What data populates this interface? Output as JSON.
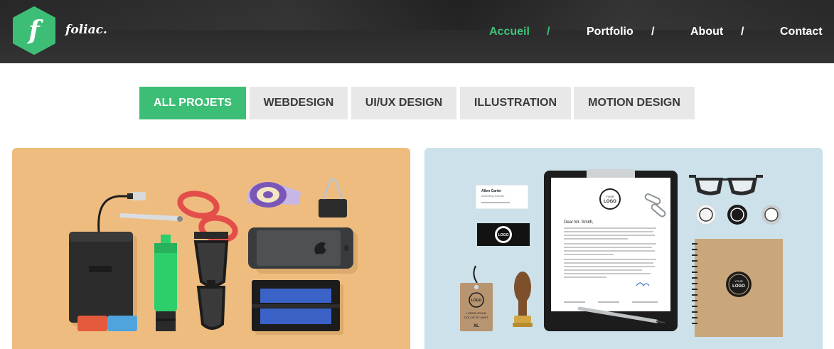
{
  "brand": {
    "logo_letter": "f",
    "name": "foliac."
  },
  "nav": {
    "items": [
      {
        "label": "Accueil",
        "active": true
      },
      {
        "label": "Portfolio",
        "active": false
      },
      {
        "label": "About",
        "active": false
      },
      {
        "label": "Contact",
        "active": false
      }
    ],
    "separator": "/"
  },
  "filters": {
    "items": [
      {
        "label": "ALL PROJETS",
        "active": true
      },
      {
        "label": "WEBDESIGN",
        "active": false
      },
      {
        "label": "UI/UX DESIGN",
        "active": false
      },
      {
        "label": "ILLUSTRATION",
        "active": false
      },
      {
        "label": "MOTION DESIGN",
        "active": false
      }
    ]
  },
  "portfolio": {
    "cards": [
      {
        "name": "flat-desk-items",
        "icons": [
          "hard-drive-icon",
          "usb-cable-icon",
          "scissors-icon",
          "tape-dispenser-icon",
          "binder-clip-icon",
          "highlighter-icon",
          "sunglasses-icon",
          "smartphone-icon",
          "eraser-icon",
          "battery-pack-icon"
        ]
      },
      {
        "name": "branding-mockup",
        "business_card": {
          "name": "Allen Carter",
          "role": "Marketing Director"
        },
        "logo_text": {
          "top": "YOUR",
          "middle": "LOGO"
        },
        "letter": {
          "greeting": "Dear Mr. Smith,"
        },
        "tag": {
          "line1": "LOREM IPSUM",
          "line2": "DOLOR SIT AMET",
          "size": "XL"
        },
        "icons": [
          "clipboard-icon",
          "glasses-icon",
          "paper-clips-icon",
          "pin-buttons-icon",
          "notebook-icon",
          "wax-stamp-icon",
          "pen-icon",
          "hang-tag-icon"
        ]
      }
    ]
  },
  "colors": {
    "accent": "#3dbe76",
    "header_bg": "#2b2b2c",
    "filter_bg": "#e8e8e8"
  }
}
